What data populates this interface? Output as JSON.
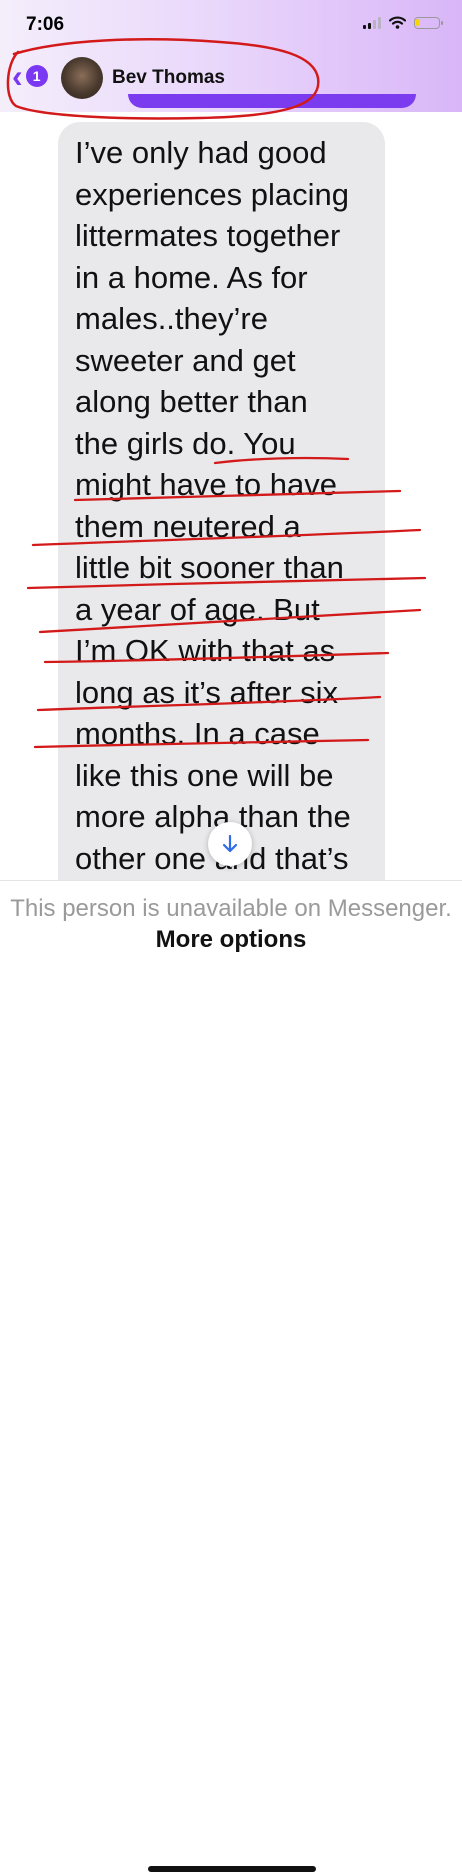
{
  "status_bar": {
    "time": "7:06",
    "battery_level": 0.15,
    "battery_color": "#f5d400"
  },
  "header": {
    "back_count": "1",
    "contact_name": "Bev Thomas",
    "accent_color": "#7b38f2"
  },
  "message": {
    "lines": [
      "I’ve only had good",
      "experiences placing",
      "littermates together",
      "in a home. As for",
      "males..they’re",
      "sweeter and get",
      "along better than",
      "the girls do. You",
      "might have to have",
      "them neutered a",
      "little bit sooner than",
      "a year of age. But",
      "I’m OK with that as",
      "long as it’s after six",
      "months. In a case",
      "like this one will be",
      "more alpha than the",
      "other one and that’s"
    ]
  },
  "footer": {
    "unavailable_text": "This person is unavailable on Messenger.",
    "more_options": "More options"
  },
  "annotation_color": "#d31a1a"
}
